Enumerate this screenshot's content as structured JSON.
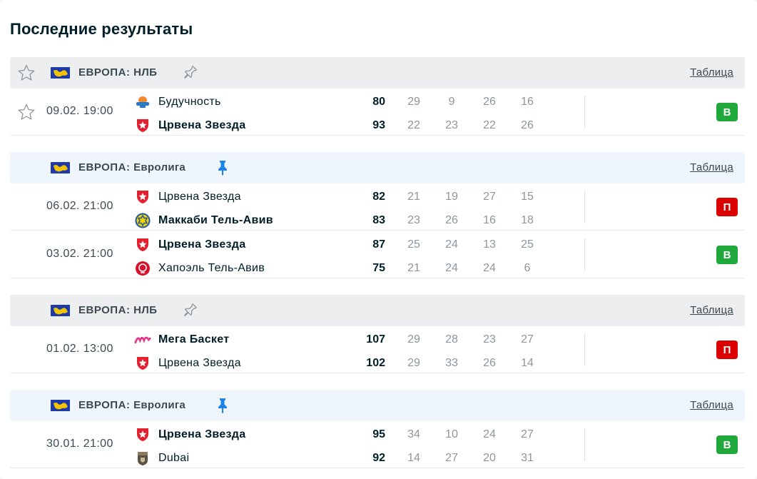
{
  "section_title": "Последние результаты",
  "colors": {
    "win": "#20a93a",
    "loss": "#dc0000",
    "pin_active": "#1a82e8",
    "pin_inactive": "#8c969c"
  },
  "blocks": [
    {
      "league": {
        "country": "ЕВРОПА",
        "competition": "НЛБ",
        "pinned": false,
        "show_star": true,
        "table_label": "Таблица",
        "style": "grey"
      },
      "matches": [
        {
          "show_star": true,
          "date": "09.02. 19:00",
          "home": {
            "name": "Будучность",
            "logo": "buducnost-logo",
            "bold": false,
            "score": "80",
            "quarters": [
              "29",
              "9",
              "26",
              "16"
            ]
          },
          "away": {
            "name": "Црвена Звезда",
            "logo": "crvena-zvezda-logo",
            "bold": true,
            "score": "93",
            "quarters": [
              "22",
              "23",
              "22",
              "26"
            ]
          },
          "result": "В",
          "result_type": "w"
        }
      ]
    },
    {
      "league": {
        "country": "ЕВРОПА",
        "competition": "Евролига",
        "pinned": true,
        "show_star": false,
        "table_label": "Таблица",
        "style": "blue"
      },
      "matches": [
        {
          "show_star": false,
          "date": "06.02. 21:00",
          "home": {
            "name": "Црвена Звезда",
            "logo": "crvena-zvezda-logo",
            "bold": false,
            "score": "82",
            "quarters": [
              "21",
              "19",
              "27",
              "15"
            ]
          },
          "away": {
            "name": "Маккаби Тель-Авив",
            "logo": "maccabi-logo",
            "bold": true,
            "score": "83",
            "quarters": [
              "23",
              "26",
              "16",
              "18"
            ]
          },
          "result": "П",
          "result_type": "l"
        },
        {
          "show_star": false,
          "date": "03.02. 21:00",
          "home": {
            "name": "Црвена Звезда",
            "logo": "crvena-zvezda-logo",
            "bold": true,
            "score": "87",
            "quarters": [
              "25",
              "24",
              "13",
              "25"
            ]
          },
          "away": {
            "name": "Хапоэль Тель-Авив",
            "logo": "hapoel-logo",
            "bold": false,
            "score": "75",
            "quarters": [
              "21",
              "24",
              "24",
              "6"
            ]
          },
          "result": "В",
          "result_type": "w"
        }
      ]
    },
    {
      "league": {
        "country": "ЕВРОПА",
        "competition": "НЛБ",
        "pinned": false,
        "show_star": false,
        "table_label": "Таблица",
        "style": "grey"
      },
      "matches": [
        {
          "show_star": false,
          "date": "01.02. 13:00",
          "home": {
            "name": "Мега Баскет",
            "logo": "mega-basket-logo",
            "bold": true,
            "score": "107",
            "quarters": [
              "29",
              "28",
              "23",
              "27"
            ]
          },
          "away": {
            "name": "Црвена Звезда",
            "logo": "crvena-zvezda-logo",
            "bold": false,
            "score": "102",
            "quarters": [
              "29",
              "33",
              "26",
              "14"
            ]
          },
          "result": "П",
          "result_type": "l"
        }
      ]
    },
    {
      "league": {
        "country": "ЕВРОПА",
        "competition": "Евролига",
        "pinned": true,
        "show_star": false,
        "table_label": "Таблица",
        "style": "blue"
      },
      "matches": [
        {
          "show_star": false,
          "date": "30.01. 21:00",
          "home": {
            "name": "Црвена Звезда",
            "logo": "crvena-zvezda-logo",
            "bold": true,
            "score": "95",
            "quarters": [
              "34",
              "10",
              "24",
              "27"
            ]
          },
          "away": {
            "name": "Dubai",
            "logo": "dubai-logo",
            "bold": false,
            "score": "92",
            "quarters": [
              "14",
              "27",
              "20",
              "31"
            ]
          },
          "result": "В",
          "result_type": "w"
        }
      ]
    }
  ]
}
